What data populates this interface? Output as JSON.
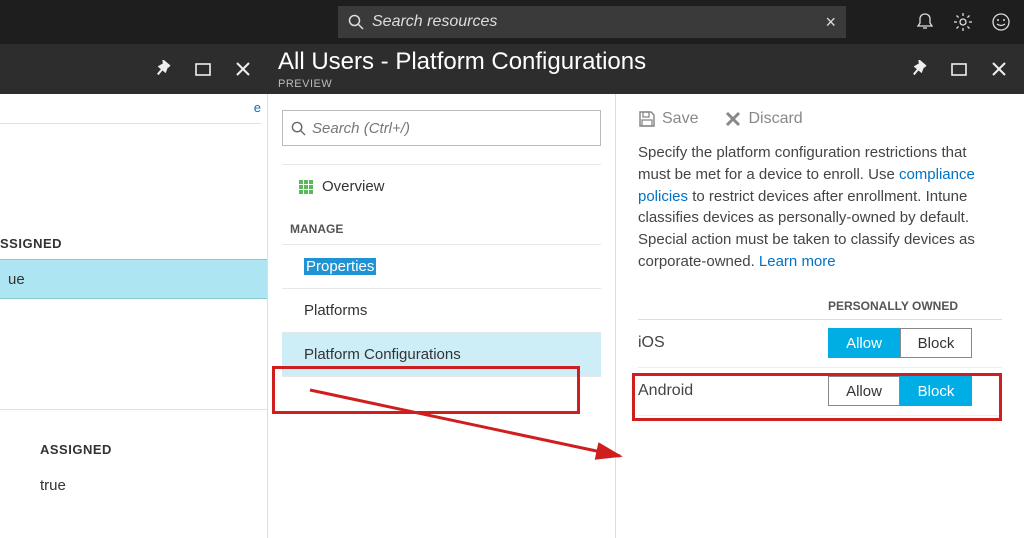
{
  "topbar": {
    "search_placeholder": "Search resources"
  },
  "blade": {
    "title": "All Users - Platform Configurations",
    "subtitle": "PREVIEW"
  },
  "col1": {
    "cutoff_link": "e",
    "label1": "SSIGNED",
    "val1": "ue",
    "label2": "ASSIGNED",
    "val2": "true"
  },
  "col2": {
    "search_placeholder": "Search (Ctrl+/)",
    "overview": "Overview",
    "section": "MANAGE",
    "items": [
      "Properties",
      "Platforms",
      "Platform Configurations"
    ]
  },
  "col3": {
    "save": "Save",
    "discard": "Discard",
    "desc1": "Specify the platform configuration restrictions that must be met for a device to enroll. Use ",
    "link1": "compliance policies",
    "desc2": " to restrict devices after enrollment. Intune classifies devices as personally-owned by default. Special action must be taken to classify devices as corporate-owned. ",
    "link2": "Learn more",
    "header_personal": "PERSONALLY OWNED",
    "rows": [
      {
        "platform": "iOS",
        "allow": "Allow",
        "block": "Block",
        "active": "allow"
      },
      {
        "platform": "Android",
        "allow": "Allow",
        "block": "Block",
        "active": "block"
      }
    ]
  }
}
